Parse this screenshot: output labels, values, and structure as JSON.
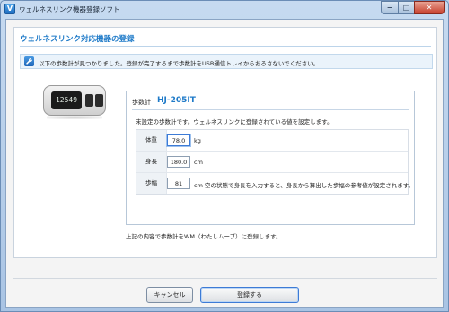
{
  "window": {
    "title": "ウェルネスリンク機器登録ソフト",
    "app_icon_glyph": "V",
    "controls": {
      "minimize": "−",
      "maximize": "□",
      "close": "✕"
    }
  },
  "panel": {
    "title": "ウェルネスリンク対応機器の登録",
    "notice": "以下の歩数計が見つかりました。登録が完了するまで歩数計をUSB通信トレイからおろさないでください。",
    "notice_icon": "wrench-icon"
  },
  "device": {
    "screen_text": "12549"
  },
  "settings": {
    "pedometer_label": "歩数計",
    "model": "HJ-205IT",
    "description": "未設定の歩数計です。ウェルネスリンクに登録されている値を設定します。",
    "fields": [
      {
        "label": "体重",
        "value": "78.0",
        "unit": "kg"
      },
      {
        "label": "身長",
        "value": "180.0",
        "unit": "cm"
      },
      {
        "label": "歩幅",
        "value": "81",
        "unit": "cm 空の状態で身長を入力すると、身長から算出した歩幅の参考値が設定されます。"
      }
    ]
  },
  "confirm_text": "上記の内容で歩数計をWM（わたしムーブ）に登録します。",
  "buttons": {
    "cancel": "キャンセル",
    "register": "登録する"
  },
  "colors": {
    "accent": "#1e7ac8",
    "frame": "#b9d1ea",
    "close": "#c7402d"
  }
}
